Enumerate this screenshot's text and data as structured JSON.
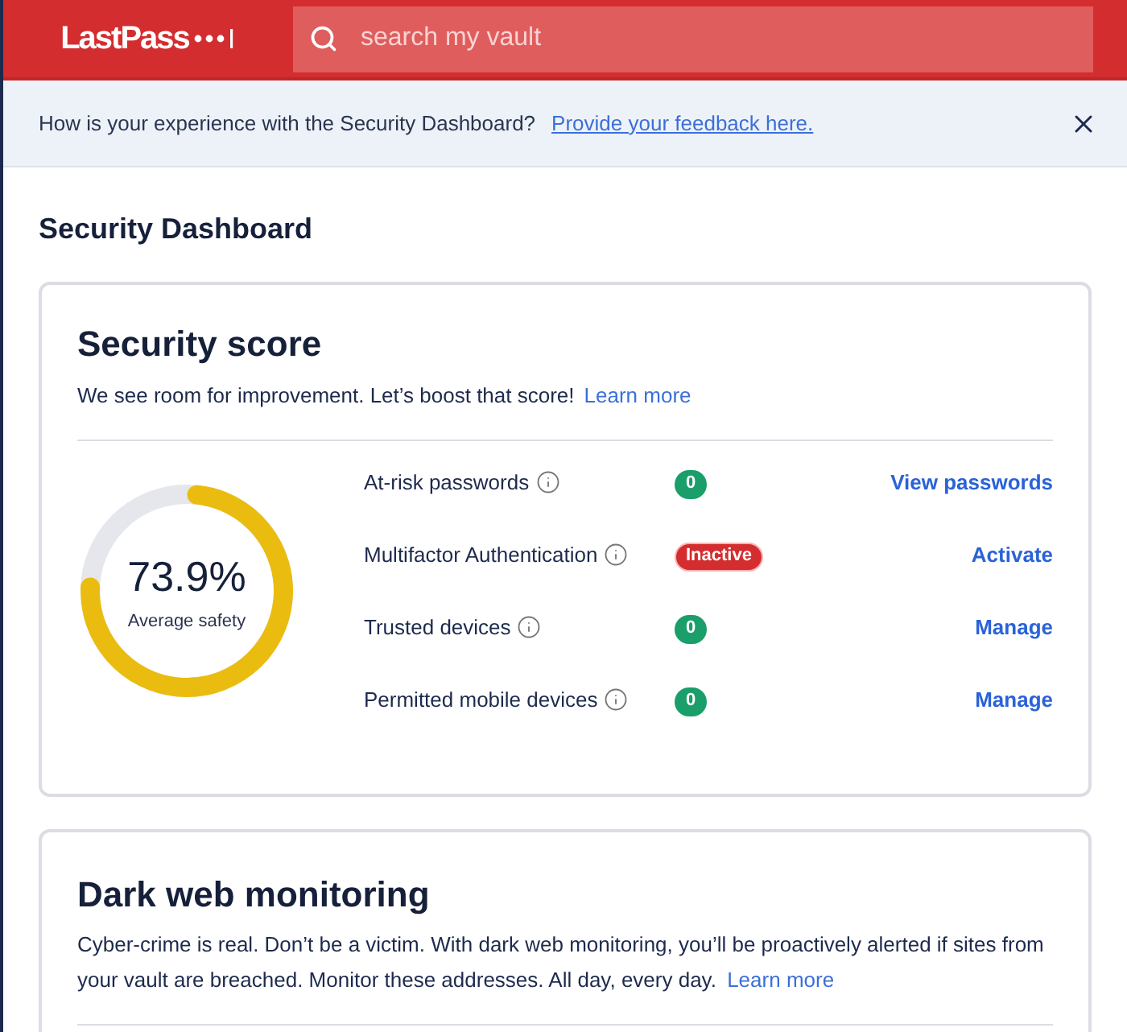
{
  "header": {
    "logo": "LastPass",
    "search": {
      "placeholder": "search my vault"
    }
  },
  "banner": {
    "text": "How is your experience with the Security Dashboard?",
    "link": "Provide your feedback here."
  },
  "page_title": "Security Dashboard",
  "score_card": {
    "title": "Security score",
    "description": "We see room for improvement. Let’s boost that score!",
    "link": "Learn more",
    "score": {
      "value": "73.9%",
      "caption": "Average safety",
      "level": 0.739
    },
    "rows": [
      {
        "label": "At-risk passwords",
        "kind": "count",
        "badge": "0",
        "action": "View passwords"
      },
      {
        "label": "Multifactor Authentication",
        "kind": "status",
        "badge": "Inactive",
        "action": "Activate"
      },
      {
        "label": "Trusted devices",
        "kind": "count",
        "badge": "0",
        "action": "Manage"
      },
      {
        "label": "Permitted mobile devices",
        "kind": "count",
        "badge": "0",
        "action": "Manage"
      }
    ]
  },
  "dark_web_card": {
    "title": "Dark web monitoring",
    "description": "Cyber-crime is real. Don’t be a victim. With dark web monitoring, you’ll be proactively alerted if sites from your vault are breached. Monitor these addresses. All day, every day.",
    "link": "Learn more"
  }
}
